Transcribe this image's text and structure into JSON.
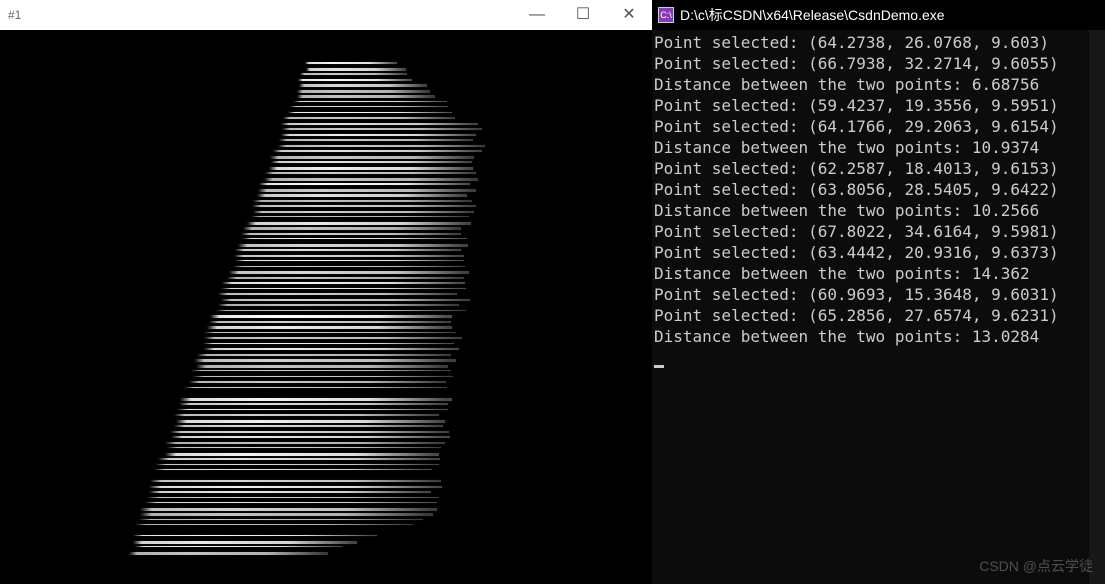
{
  "left_window": {
    "title": "#1",
    "controls": {
      "minimize": "—",
      "maximize": "☐",
      "close": "✕"
    }
  },
  "right_window": {
    "icon_label": "C:\\",
    "title": "D:\\c\\标CSDN\\x64\\Release\\CsdnDemo.exe"
  },
  "console_lines": [
    "Point selected: (64.2738, 26.0768, 9.603)",
    "Point selected: (66.7938, 32.2714, 9.6055)",
    "Distance between the two points: 6.68756",
    "Point selected: (59.4237, 19.3556, 9.5951)",
    "Point selected: (64.1766, 29.2063, 9.6154)",
    "Distance between the two points: 10.9374",
    "Point selected: (62.2587, 18.4013, 9.6153)",
    "Point selected: (63.8056, 28.5405, 9.6422)",
    "Distance between the two points: 10.2566",
    "Point selected: (67.8022, 34.6164, 9.5981)",
    "Point selected: (63.4442, 20.9316, 9.6373)",
    "Distance between the two points: 14.362",
    "Point selected: (60.9693, 15.3648, 9.6031)",
    "Point selected: (65.2856, 27.6574, 9.6231)",
    "Distance between the two points: 13.0284"
  ],
  "watermark": "CSDN @点云学徒"
}
